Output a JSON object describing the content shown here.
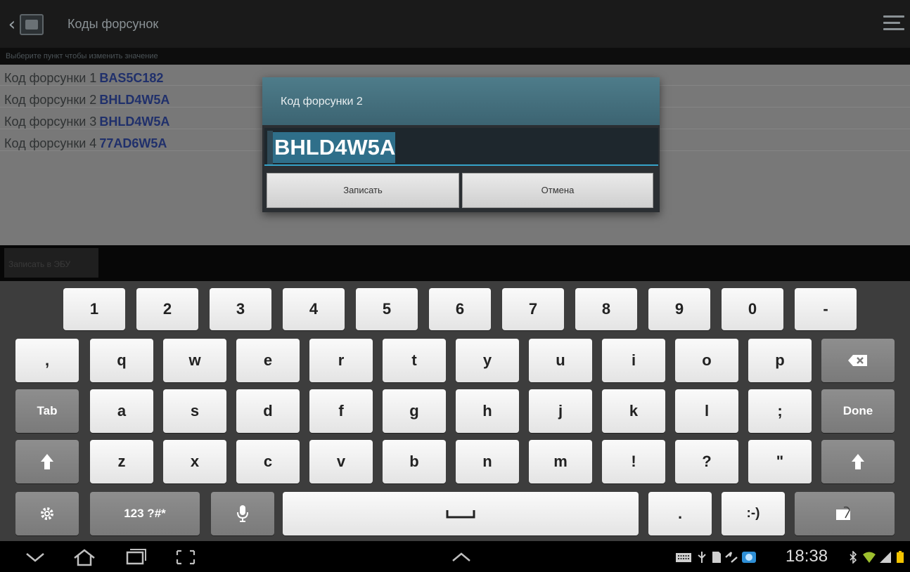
{
  "action_bar": {
    "title": "Коды форсунок",
    "hint": "Выберите пункт чтобы изменить значение"
  },
  "list": {
    "rows": [
      {
        "label": "Код форсунки 1",
        "value": "BAS5C182"
      },
      {
        "label": "Код форсунки 2",
        "value": "BHLD4W5A"
      },
      {
        "label": "Код форсунки 3",
        "value": "BHLD4W5A"
      },
      {
        "label": "Код форсунки 4",
        "value": "77AD6W5A"
      }
    ]
  },
  "write_bar": {
    "button_label": "Записать в ЭБУ"
  },
  "dialog": {
    "title": "Код форсунки 2",
    "input_value": "BHLD4W5A",
    "save_label": "Записать",
    "cancel_label": "Отмена"
  },
  "keyboard": {
    "row1": [
      "1",
      "2",
      "3",
      "4",
      "5",
      "6",
      "7",
      "8",
      "9",
      "0",
      "-"
    ],
    "row2": [
      ",",
      "q",
      "w",
      "e",
      "r",
      "t",
      "y",
      "u",
      "i",
      "o",
      "p"
    ],
    "row3": [
      "Tab",
      "a",
      "s",
      "d",
      "f",
      "g",
      "h",
      "j",
      "k",
      "l",
      ";",
      "Done"
    ],
    "row4": [
      "z",
      "x",
      "c",
      "v",
      "b",
      "n",
      "m",
      "!",
      "?",
      "\""
    ],
    "symbols_label": "123 ?#*",
    "period": ".",
    "smiley": ":-)",
    "colors": {
      "key_light": "#f0f0f0",
      "key_dark": "#828282",
      "background": "#3d3d3d"
    }
  },
  "status": {
    "time": "18:38"
  }
}
